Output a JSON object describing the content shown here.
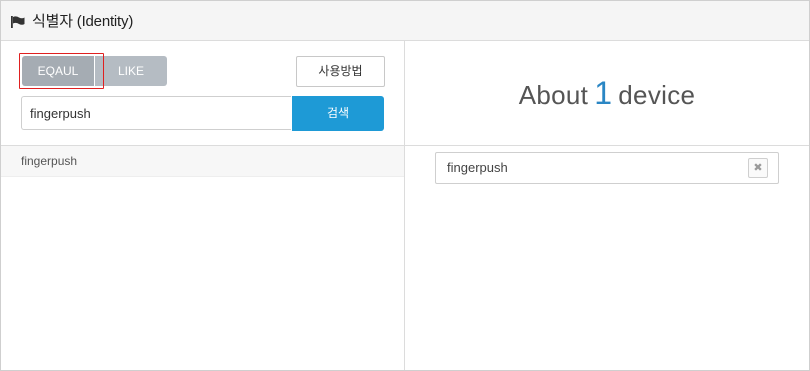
{
  "header": {
    "title": "식별자 (Identity)",
    "icon": "flag-icon"
  },
  "match_mode": {
    "options": [
      "EQAUL",
      "LIKE"
    ],
    "selected": "EQAUL"
  },
  "howto_label": "사용방법",
  "search": {
    "value": "fingerpush",
    "button_label": "검색"
  },
  "results": [
    {
      "label": "fingerpush"
    }
  ],
  "summary": {
    "prefix": "About",
    "count": "1",
    "suffix": "device"
  },
  "selected_tags": [
    {
      "label": "fingerpush",
      "remove_icon": "close-icon"
    }
  ],
  "colors": {
    "primary": "#1e9ad6",
    "segment": "#b5bcc3",
    "highlight": "#e02020",
    "count": "#2a86c4"
  }
}
